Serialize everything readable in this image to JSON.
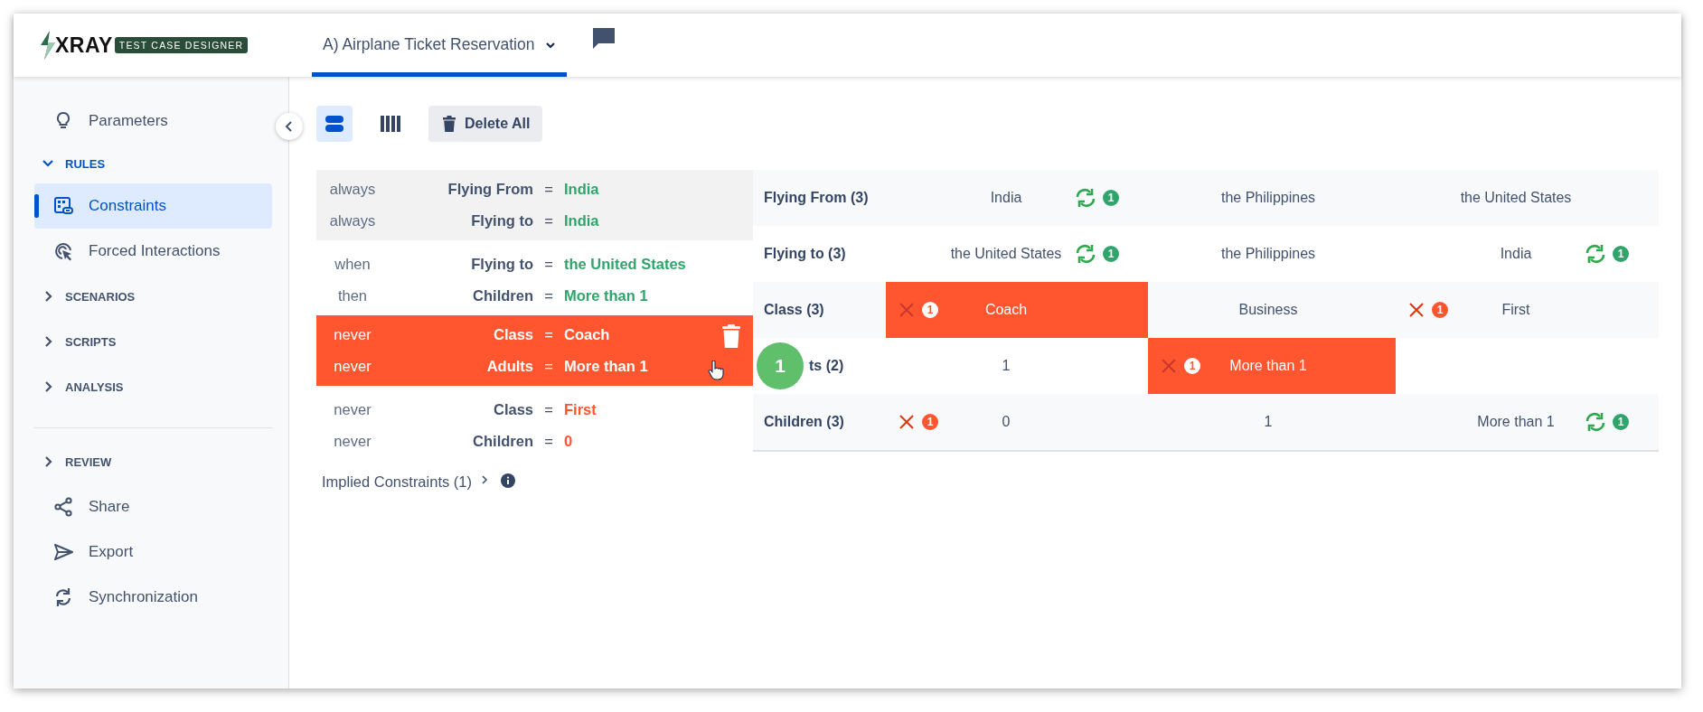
{
  "header": {
    "logo": {
      "wordmark": "XRAY",
      "badge": "TEST CASE DESIGNER"
    },
    "tab": {
      "label": "A) Airplane Ticket Reservation",
      "selected": true
    }
  },
  "sidebar": {
    "groups": [
      [
        {
          "kind": "link",
          "label": "Parameters",
          "selected": false
        },
        {
          "kind": "section",
          "label": "RULES",
          "expanded": true,
          "children": [
            {
              "label": "Constraints",
              "selected": true
            },
            {
              "label": "Forced Interactions",
              "selected": false
            }
          ]
        },
        {
          "kind": "section",
          "label": "SCENARIOS",
          "expanded": false
        },
        {
          "kind": "section",
          "label": "SCRIPTS",
          "expanded": false
        },
        {
          "kind": "section",
          "label": "ANALYSIS",
          "expanded": false
        }
      ],
      [
        {
          "kind": "section",
          "label": "REVIEW",
          "expanded": false
        },
        {
          "kind": "link",
          "label": "Share",
          "selected": false
        },
        {
          "kind": "link",
          "label": "Export",
          "selected": false
        },
        {
          "kind": "link",
          "label": "Synchronization",
          "selected": false
        }
      ]
    ]
  },
  "toolbar": {
    "views": [
      {
        "selected": true
      },
      {
        "selected": false
      }
    ],
    "delete_button": "Delete All"
  },
  "rules": {
    "groups": [
      {
        "shaded": true,
        "highlighted": false,
        "kind": "include",
        "lines": [
          {
            "keyword": "always",
            "parameter": "Flying From",
            "operator": "=",
            "value": "India"
          },
          {
            "keyword": "always",
            "parameter": "Flying to",
            "operator": "=",
            "value": "India"
          }
        ]
      },
      {
        "shaded": false,
        "highlighted": false,
        "kind": "include",
        "lines": [
          {
            "keyword": "when",
            "parameter": "Flying to",
            "operator": "=",
            "value": "the United States"
          },
          {
            "keyword": "then",
            "parameter": "Children",
            "operator": "=",
            "value": "More than 1"
          }
        ]
      },
      {
        "shaded": false,
        "highlighted": true,
        "kind": "exclude",
        "lines": [
          {
            "keyword": "never",
            "parameter": "Class",
            "operator": "=",
            "value": "Coach"
          },
          {
            "keyword": "never",
            "parameter": "Adults",
            "operator": "=",
            "value": "More than 1"
          }
        ]
      },
      {
        "shaded": false,
        "highlighted": false,
        "kind": "exclude",
        "lines": [
          {
            "keyword": "never",
            "parameter": "Class",
            "operator": "=",
            "value": "First"
          },
          {
            "keyword": "never",
            "parameter": "Children",
            "operator": "=",
            "value": "0"
          }
        ]
      }
    ],
    "implied": "Implied Constraints (1)"
  },
  "table": {
    "rows": [
      {
        "label": "Flying From (3)",
        "cells": [
          {
            "value": "India",
            "highlighted": false,
            "marks": [
              {
                "kind": "forced",
                "count": "1"
              }
            ]
          },
          {
            "value": "the Philippines",
            "highlighted": false
          },
          {
            "value": "the United States",
            "highlighted": false
          }
        ]
      },
      {
        "label": "Flying to (3)",
        "cells": [
          {
            "value": "the United States",
            "highlighted": false,
            "marks": [
              {
                "kind": "forced",
                "count": "1"
              }
            ]
          },
          {
            "value": "the Philippines",
            "highlighted": false
          },
          {
            "value": "India",
            "highlighted": false,
            "marks": [
              {
                "kind": "forced",
                "count": "1"
              }
            ]
          }
        ]
      },
      {
        "label": "Class (3)",
        "cells": [
          {
            "value": "Coach",
            "highlighted": true,
            "marks": [
              {
                "kind": "excluded",
                "count": "1"
              }
            ]
          },
          {
            "value": "Business",
            "highlighted": false
          },
          {
            "value": "First",
            "highlighted": false,
            "marks": [
              {
                "kind": "excluded",
                "count": "1"
              }
            ]
          }
        ]
      },
      {
        "label": "ts (2)",
        "step_badge": "1",
        "cells": [
          {
            "value": "1",
            "highlighted": false
          },
          {
            "value": "More than 1",
            "highlighted": true,
            "marks": [
              {
                "kind": "excluded",
                "count": "1"
              }
            ]
          }
        ]
      },
      {
        "label": "Children (3)",
        "cells": [
          {
            "value": "0",
            "highlighted": false,
            "marks": [
              {
                "kind": "excluded",
                "count": "1"
              }
            ]
          },
          {
            "value": "1",
            "highlighted": false
          },
          {
            "value": "More than 1",
            "highlighted": false,
            "marks": [
              {
                "kind": "forced",
                "count": "1"
              }
            ]
          }
        ]
      }
    ]
  }
}
